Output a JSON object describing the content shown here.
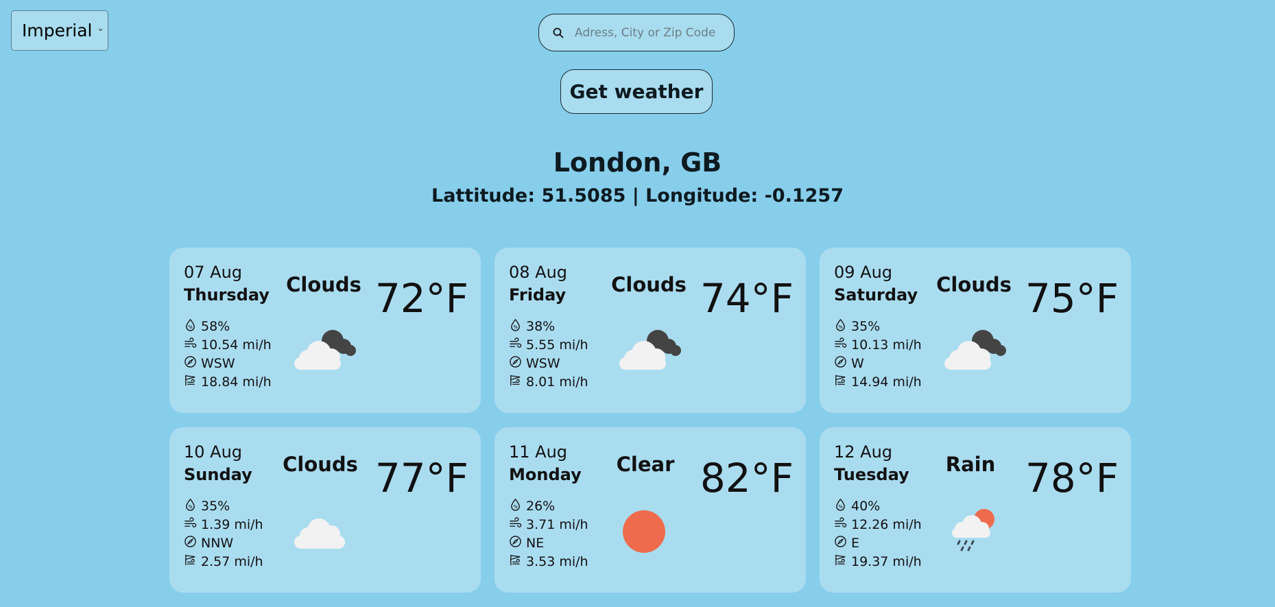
{
  "units": {
    "selected": "Imperial"
  },
  "search": {
    "placeholder": "Adress, City or Zip Code",
    "value": ""
  },
  "get_weather_label": "Get weather",
  "location": {
    "city": "London, GB",
    "coords": "Lattitude: 51.5085 | Longitude: -0.1257"
  },
  "icons": {
    "humidity": "humidity-drop-icon",
    "wind": "wind-icon",
    "direction": "compass-icon",
    "gust": "wind-gust-flag-icon"
  },
  "colors": {
    "background": "#87ceeb",
    "card": "#aadcf0",
    "sun": "#ee6c4d",
    "cloud_light": "#f2f2f2",
    "cloud_dark": "#444444"
  },
  "forecast": [
    {
      "date": "07 Aug",
      "day": "Thursday",
      "condition": "Clouds",
      "temp": "72°F",
      "humidity": "58%",
      "wind": "10.54 mi/h",
      "direction": "WSW",
      "gust": "18.84 mi/h",
      "icon": "broken-clouds-icon"
    },
    {
      "date": "08 Aug",
      "day": "Friday",
      "condition": "Clouds",
      "temp": "74°F",
      "humidity": "38%",
      "wind": "5.55 mi/h",
      "direction": "WSW",
      "gust": "8.01 mi/h",
      "icon": "broken-clouds-icon"
    },
    {
      "date": "09 Aug",
      "day": "Saturday",
      "condition": "Clouds",
      "temp": "75°F",
      "humidity": "35%",
      "wind": "10.13 mi/h",
      "direction": "W",
      "gust": "14.94 mi/h",
      "icon": "broken-clouds-icon"
    },
    {
      "date": "10 Aug",
      "day": "Sunday",
      "condition": "Clouds",
      "temp": "77°F",
      "humidity": "35%",
      "wind": "1.39 mi/h",
      "direction": "NNW",
      "gust": "2.57 mi/h",
      "icon": "cloud-icon"
    },
    {
      "date": "11 Aug",
      "day": "Monday",
      "condition": "Clear",
      "temp": "82°F",
      "humidity": "26%",
      "wind": "3.71 mi/h",
      "direction": "NE",
      "gust": "3.53 mi/h",
      "icon": "sun-icon"
    },
    {
      "date": "12 Aug",
      "day": "Tuesday",
      "condition": "Rain",
      "temp": "78°F",
      "humidity": "40%",
      "wind": "12.26 mi/h",
      "direction": "E",
      "gust": "19.37 mi/h",
      "icon": "rain-sun-icon"
    }
  ]
}
